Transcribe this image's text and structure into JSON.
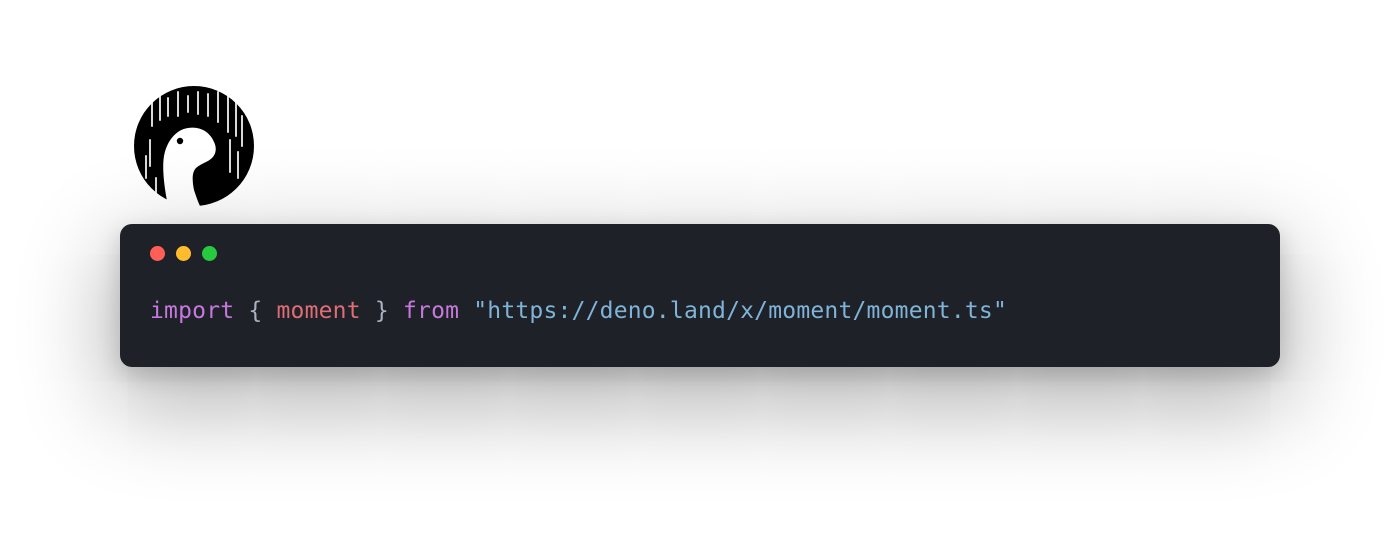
{
  "logo": {
    "name": "deno-logo",
    "colors": {
      "bg": "#000000",
      "fg": "#ffffff"
    }
  },
  "window": {
    "traffic_light_colors": {
      "close": "#ff5f56",
      "minimize": "#ffbd2e",
      "zoom": "#27c93f"
    },
    "code": {
      "keyword_import": "import",
      "brace_open": "{",
      "identifier": "moment",
      "brace_close": "}",
      "keyword_from": "from",
      "string_literal": "\"https://deno.land/x/moment/moment.ts\""
    }
  }
}
